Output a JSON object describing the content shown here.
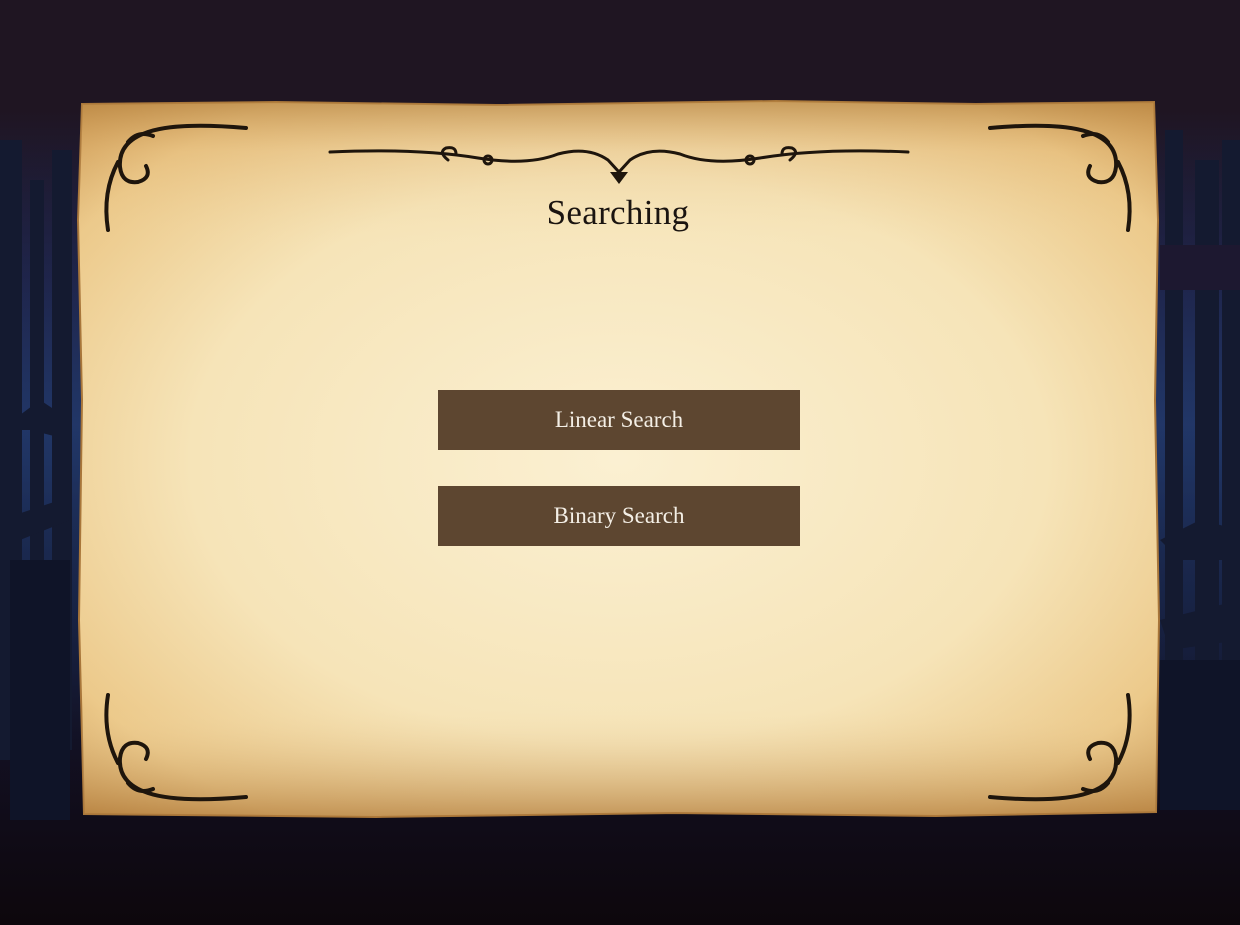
{
  "screen": {
    "title": "Searching"
  },
  "menu": {
    "buttons": [
      {
        "label": "Linear Search"
      },
      {
        "label": "Binary Search"
      }
    ]
  },
  "colors": {
    "background_top": "#1f1522",
    "background_mid": "#16203f",
    "background_bottom": "#0d070c",
    "parchment_light": "#f7e6bf",
    "parchment_edge": "#c99a55",
    "button_fill": "#5d4630",
    "button_text": "#f4efe6",
    "title_text": "#1a1410",
    "ornament": "#1e150c"
  },
  "icons": {
    "top_flourish": "ornamental-divider-icon",
    "corners": [
      "corner-flourish-top-left-icon",
      "corner-flourish-top-right-icon",
      "corner-flourish-bottom-left-icon",
      "corner-flourish-bottom-right-icon"
    ]
  }
}
